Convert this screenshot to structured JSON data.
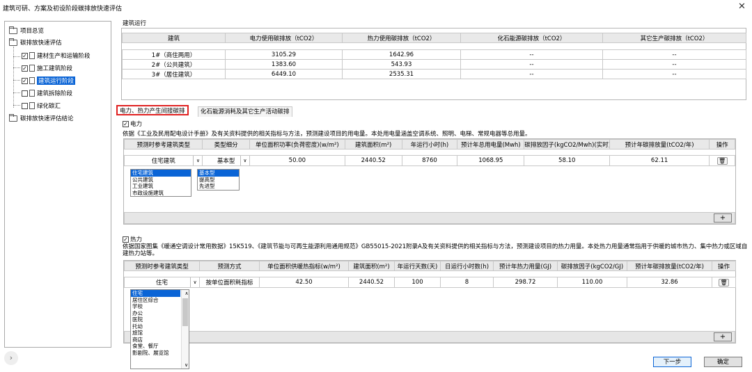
{
  "window": {
    "title": "建筑可研、方案及初设阶段碳排放快速评估",
    "close": "✕"
  },
  "tree": {
    "items": [
      {
        "label": "项目总览",
        "type": "folder"
      },
      {
        "label": "碳排放快速评估",
        "type": "folder"
      },
      {
        "label": "建材生产和运输阶段",
        "type": "doc",
        "checked": true
      },
      {
        "label": "施工建筑阶段",
        "type": "doc",
        "checked": true
      },
      {
        "label": "建筑运行阶段",
        "type": "doc",
        "checked": true,
        "selected": true
      },
      {
        "label": "建筑拆除阶段",
        "type": "doc",
        "checked": false
      },
      {
        "label": "绿化碳汇",
        "type": "doc",
        "checked": false
      },
      {
        "label": "碳排放快速评估结论",
        "type": "folder"
      }
    ],
    "check_mark": "✓",
    "expand": "›"
  },
  "operation": {
    "section_title": "建筑运行",
    "headers": [
      "建筑",
      "电力使用碳排放（tCO2）",
      "热力使用碳排放（tCO2）",
      "化石能源碳排放（tCO2）",
      "其它生产碳排放（tCO2）"
    ],
    "rows": [
      [
        "1#（商住两用）",
        "3105.29",
        "1642.96",
        "--",
        "--"
      ],
      [
        "2#（公共建筑）",
        "1383.60",
        "543.93",
        "--",
        "--"
      ],
      [
        "3#（居住建筑）",
        "6449.10",
        "2535.31",
        "--",
        "--"
      ]
    ]
  },
  "tabs": [
    {
      "label": "电力、热力产生间接碳排",
      "active": true
    },
    {
      "label": "化石能源消耗及其它生产活动碳排",
      "active": false
    }
  ],
  "electricity": {
    "checkbox_label": "电力",
    "check": "✓",
    "description": "依据《工业及民用配电设计手册》及有关资料提供的相关指标与方法，预测建设项目的用电量。本处用电量涵盖空调系统、照明、电梯、常规电器等总用量。",
    "headers": [
      "预测时参考建筑类型",
      "类型细分",
      "单位面积功率(负荷密度)(w/m²)",
      "建筑面积(m²)",
      "年运行小时(h)",
      "预计年总用电量(Mwh)",
      "碳排放因子(kgCO2/Mwh)(实时)",
      "预计年碳排放量(tCO2/年)",
      "操作"
    ],
    "row": [
      "住宅建筑",
      "基本型",
      "50.00",
      "2440.52",
      "8760",
      "1068.95",
      "58.10",
      "62.11"
    ],
    "type_options": [
      "住宅建筑",
      "公共建筑",
      "工业建筑",
      "市政设施建筑"
    ],
    "sub_options": [
      "基本型",
      "提高型",
      "先进型"
    ],
    "add": "+",
    "arrow": "∨",
    "trash": "🗑"
  },
  "heat": {
    "checkbox_label": "热力",
    "check": "✓",
    "description": "依据国家图集《暖通空调设计常用数据》15K519、《建筑节能与可再生能源利用通用规范》GB55015-2021附录A及有关资料提供的相关指标与方法，预测建设项目的热力用量。本处热力用量通常指用于供暖的城市热力、集中热力或区域自建热力站等。",
    "headers": [
      "预测时参考建筑类型",
      "预测方式",
      "单位面积供暖热指标(w/m²)",
      "建筑面积(m²)",
      "年运行天数(天)",
      "日运行小时数(h)",
      "预计年热力用量(GJ)",
      "碳排放因子(kgCO2/GJ)",
      "预计年碳排放量(tCO2/年)",
      "操作"
    ],
    "row": [
      "住宅",
      "按单位面积耗指标",
      "42.50",
      "2440.52",
      "100",
      "8",
      "298.72",
      "110.00",
      "32.86"
    ],
    "type_options": [
      "住宅",
      "居住区综合",
      "学校",
      "办公",
      "医院",
      "托幼",
      "旅馆",
      "商店",
      "食堂、餐厅",
      "影剧院、展览馆"
    ],
    "add": "+",
    "arrow": "∨",
    "up": "∧",
    "trash": "🗑"
  },
  "footer": {
    "next": "下一步",
    "ok": "确定"
  }
}
